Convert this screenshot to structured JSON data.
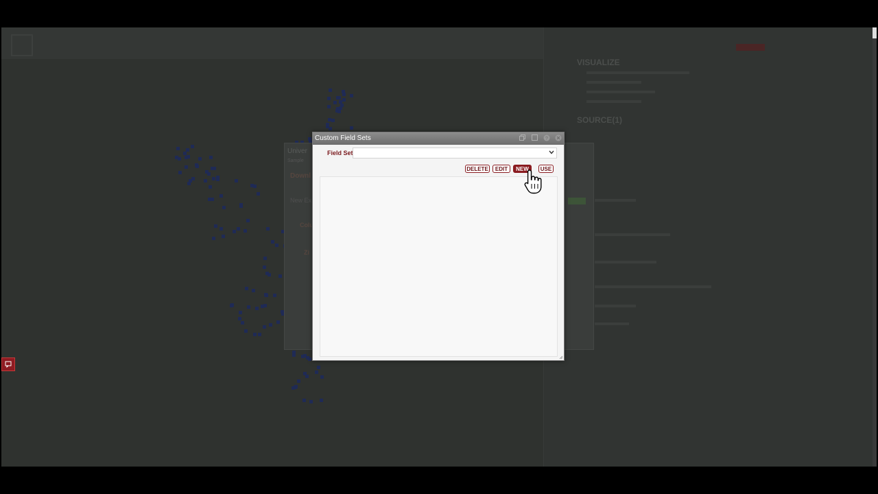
{
  "dialog": {
    "title": "Custom Field Sets",
    "field_label": "Field Set",
    "field_value": "",
    "buttons": {
      "delete": "DELETE",
      "edit": "EDIT",
      "new": "NEW",
      "use": "USE"
    },
    "title_icons": [
      "restore-icon",
      "maximize-icon",
      "help-icon",
      "close-icon"
    ]
  },
  "background": {
    "sidebar_title": "VISUALIZE",
    "sidebar_subtitle": "SOURCE(1)",
    "panel_title": "Univer",
    "panel_subtitle": "Sample",
    "panel_heading": "Downl",
    "panel_label_1": "New Ex",
    "panel_label_2": "Colu",
    "panel_label_3": "Zi"
  },
  "colors": {
    "accent": "#8a1b20",
    "title_bar": "#7a7a7a",
    "overlay": "#2e312f"
  },
  "icons": {
    "chat": "chat-icon",
    "cursor": "hand-pointer-icon"
  }
}
